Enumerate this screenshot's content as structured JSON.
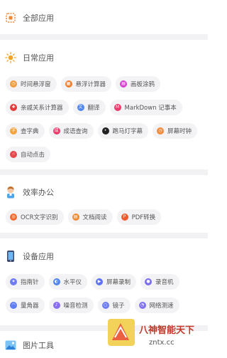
{
  "sections": {
    "all": {
      "title": "全部应用",
      "icon": "grid-icon"
    },
    "daily": {
      "title": "日常应用",
      "icon": "sun-icon",
      "items": [
        {
          "label": "时间悬浮窗",
          "icon": "clock-icon",
          "color": "#f39c3d"
        },
        {
          "label": "悬浮计算器",
          "icon": "calculator-icon",
          "color": "#f07f2f"
        },
        {
          "label": "画板涂鸦",
          "icon": "palette-icon",
          "color": "#d63fd0"
        },
        {
          "label": "亲戚关系计算器",
          "icon": "family-icon",
          "color": "#e43a3a"
        },
        {
          "label": "翻译",
          "icon": "translate-icon",
          "color": "#4f86ef"
        },
        {
          "label": "MarkDown 记事本",
          "icon": "markdown-icon",
          "color": "#ee3a6a"
        },
        {
          "label": "查字典",
          "icon": "dictionary-icon",
          "color": "#f2a23a"
        },
        {
          "label": "成语查询",
          "icon": "idiom-icon",
          "color": "#ea3a6a"
        },
        {
          "label": "跑马灯字幕",
          "icon": "marquee-icon",
          "color": "#222222"
        },
        {
          "label": "屏幕时钟",
          "icon": "screen-clock-icon",
          "color": "#f08a3a"
        },
        {
          "label": "自动点击",
          "icon": "autoclick-icon",
          "color": "#e5484d"
        }
      ]
    },
    "office": {
      "title": "效率办公",
      "icon": "worker-icon",
      "items": [
        {
          "label": "OCR文字识别",
          "icon": "ocr-icon",
          "color": "#f06a2f"
        },
        {
          "label": "文档阅读",
          "icon": "document-icon",
          "color": "#f28a2f"
        },
        {
          "label": "PDF转换",
          "icon": "pdf-icon",
          "color": "#ef5a2f"
        }
      ]
    },
    "device": {
      "title": "设备应用",
      "icon": "phone-icon",
      "items": [
        {
          "label": "指南针",
          "icon": "compass-icon",
          "color": "#6f7cf5"
        },
        {
          "label": "水平仪",
          "icon": "level-icon",
          "color": "#4f86ef"
        },
        {
          "label": "屏幕录制",
          "icon": "record-icon",
          "color": "#5f73f0"
        },
        {
          "label": "录音机",
          "icon": "mic-icon",
          "color": "#7a6ef0"
        },
        {
          "label": "量角器",
          "icon": "protractor-icon",
          "color": "#5f7ef5"
        },
        {
          "label": "噪音检测",
          "icon": "noise-icon",
          "color": "#8a6ef0"
        },
        {
          "label": "镜子",
          "icon": "mirror-icon",
          "color": "#6f7cf5"
        },
        {
          "label": "网络测速",
          "icon": "speedtest-icon",
          "color": "#7f73f0"
        }
      ]
    },
    "image": {
      "title": "图片工具",
      "icon": "image-icon"
    }
  },
  "watermark": {
    "line1": "八神智能天下",
    "line2": "zntx.cc"
  }
}
